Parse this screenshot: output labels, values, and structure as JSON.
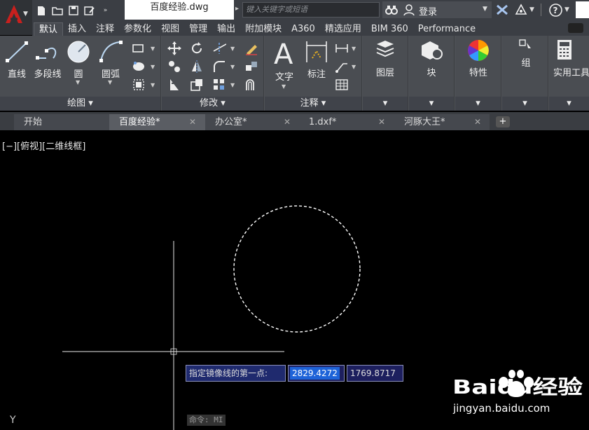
{
  "titlebar": {
    "document_title": "百度经验.dwg",
    "search_placeholder": "键入关键字或短语",
    "login_label": "登录"
  },
  "ribbon_tabs": [
    "默认",
    "插入",
    "注释",
    "参数化",
    "视图",
    "管理",
    "输出",
    "附加模块",
    "A360",
    "精选应用",
    "BIM 360",
    "Performance"
  ],
  "panels": {
    "draw": {
      "title": "绘图 ▾",
      "tools": [
        "直线",
        "多段线",
        "圆",
        "圆弧"
      ]
    },
    "modify": {
      "title": "修改 ▾"
    },
    "annotation": {
      "title": "注释 ▾",
      "tools": [
        "文字",
        "标注"
      ]
    },
    "layers": {
      "label": "图层"
    },
    "block": {
      "label": "块"
    },
    "properties": {
      "label": "特性"
    },
    "groups": {
      "label": "组"
    },
    "utilities": {
      "label": "实用工具"
    }
  },
  "doc_tabs": [
    {
      "label": "开始",
      "active": false
    },
    {
      "label": "百度经验*",
      "active": true
    },
    {
      "label": "办公室*",
      "active": false
    },
    {
      "label": "1.dxf*",
      "active": false
    },
    {
      "label": "河豚大王*",
      "active": false
    }
  ],
  "viewport": {
    "label": "[−][俯视][二维线框]"
  },
  "dynamic_input": {
    "prompt": "指定镜像线的第一点:",
    "x_value": "2829.4272",
    "y_value": "1769.8717"
  },
  "command_line": "命令: MI",
  "axis_label": "Y",
  "watermark": {
    "brand": "Baidu经验",
    "url": "jingyan.baidu.com"
  },
  "colors": {
    "app_red": "#c8201e",
    "titlebar": "#3b3e44",
    "ribbon": "#505358",
    "prompt_bg": "#1f2a6e",
    "highlight": "#1e63d8"
  }
}
